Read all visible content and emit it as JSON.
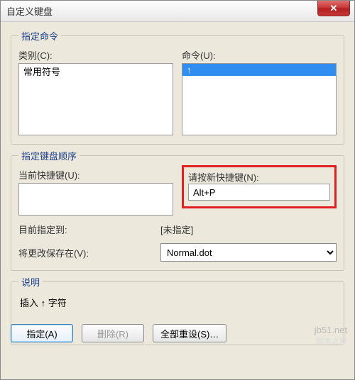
{
  "window": {
    "title": "自定义键盘",
    "close_glyph": "✕"
  },
  "section_command": {
    "legend": "指定命令",
    "category_label": "类别(C):",
    "commands_label": "命令(U):",
    "category_items": [
      "常用符号"
    ],
    "command_items": [
      "↑"
    ],
    "command_selected": 0
  },
  "section_keys": {
    "legend": "指定键盘顺序",
    "current_label": "当前快捷键(U):",
    "press_new_label": "请按新快捷键(N):",
    "new_key_value": "Alt+P"
  },
  "assigned": {
    "label": "目前指定到:",
    "value": "[未指定]"
  },
  "save_in": {
    "label": "将更改保存在(V):",
    "options": [
      "Normal.dot"
    ],
    "value": "Normal.dot"
  },
  "description": {
    "legend": "说明",
    "text": "插入 ↑ 字符"
  },
  "buttons": {
    "assign": "指定(A)",
    "remove": "删除(R)",
    "reset_all": "全部重设(S)…"
  },
  "watermark": {
    "line1": "jb51.net",
    "line2": "脚本之家"
  }
}
